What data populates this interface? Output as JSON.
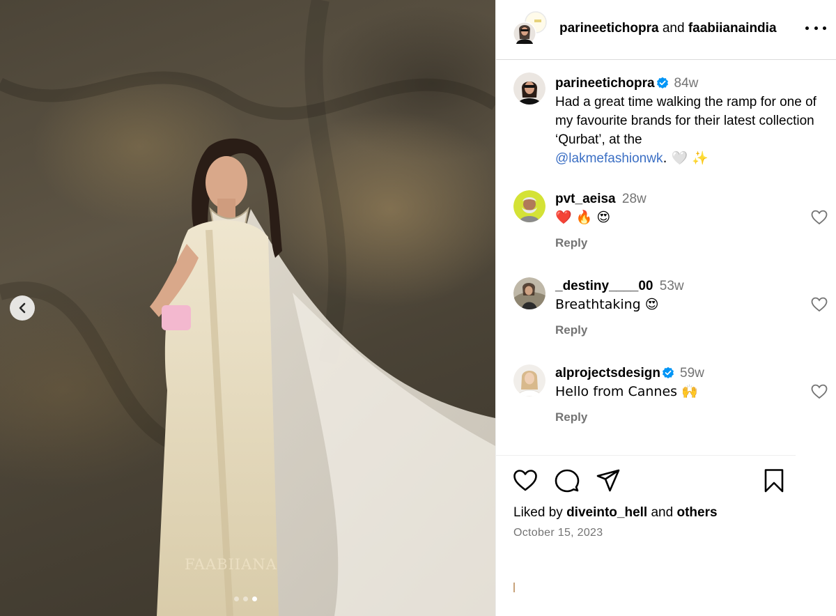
{
  "post": {
    "header": {
      "author": "parineetichopra",
      "joiner": "and",
      "collaborator": "faabiianaindia"
    },
    "caption": {
      "username": "parineetichopra",
      "time": "84w",
      "text": "Had a great time walking the ramp for one of my favourite brands for their latest collection ‘Qurbat’, at the",
      "mention": "@lakmefashionwk",
      "suffix": ". 🤍 ✨"
    },
    "comments": [
      {
        "username": "pvt_aeisa",
        "time": "28w",
        "text": "❤️ 🔥 😍",
        "reply": "Reply",
        "verified": false
      },
      {
        "username": "_destiny____00",
        "time": "53w",
        "text": "Breathtaking 😍",
        "reply": "Reply",
        "verified": false
      },
      {
        "username": "alprojectsdesign",
        "time": "59w",
        "text": "Hello from Cannes 🙌",
        "reply": "Reply",
        "verified": true
      }
    ],
    "likes": {
      "prefix": "Liked by",
      "user": "diveinto_hell",
      "joiner": "and",
      "others": "others"
    },
    "date": "October 15, 2023",
    "media": {
      "watermark": "FAABIIANA",
      "slide_count": 3,
      "active_slide": 3
    }
  },
  "colors": {
    "verified": "#0095f6",
    "secondary_text": "#737373",
    "mention": "#3b6fc4",
    "divider": "#dbdbdb"
  },
  "icons": [
    "chevron-left-icon",
    "more-icon",
    "verified-icon",
    "heart-icon",
    "comment-icon",
    "share-icon",
    "bookmark-icon"
  ]
}
